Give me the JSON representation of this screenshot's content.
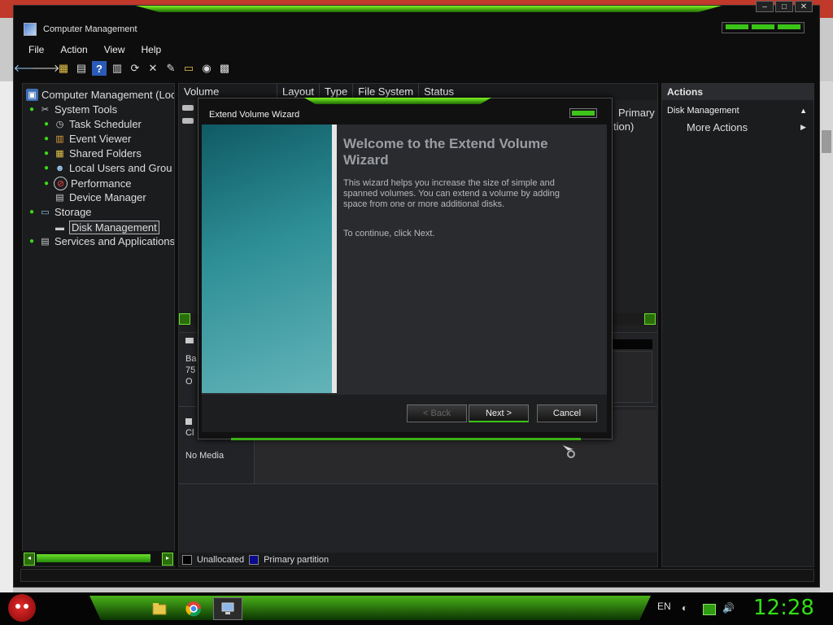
{
  "window": {
    "title": "Computer Management",
    "buttons": {
      "minimize": "–",
      "maximize": "□",
      "close": "✕"
    }
  },
  "menubar": [
    {
      "label": "File"
    },
    {
      "label": "Action"
    },
    {
      "label": "View"
    },
    {
      "label": "Help"
    }
  ],
  "toolbar": [
    {
      "icon": "back-arrow-icon",
      "glyph": "🡐"
    },
    {
      "icon": "forward-arrow-icon",
      "glyph": "🡒"
    },
    {
      "icon": "folder-up-icon",
      "glyph": "▦"
    },
    {
      "icon": "show-hide-console-tree-icon",
      "glyph": "▤"
    },
    {
      "icon": "help-icon",
      "glyph": "?"
    },
    {
      "icon": "properties-icon",
      "glyph": "▥"
    },
    {
      "icon": "refresh-icon",
      "glyph": "⟳"
    },
    {
      "icon": "delete-icon",
      "glyph": "✕"
    },
    {
      "icon": "edit-icon",
      "glyph": "✎"
    },
    {
      "icon": "open-folder-icon",
      "glyph": "▭"
    },
    {
      "icon": "search-disk-icon",
      "glyph": "◉"
    },
    {
      "icon": "grid-icon",
      "glyph": "▩"
    }
  ],
  "tree": {
    "root": "Computer Management (Loc",
    "system_tools": "System Tools",
    "task_scheduler": "Task Scheduler",
    "event_viewer": "Event Viewer",
    "shared_folders": "Shared Folders",
    "local_users": "Local Users and Grou",
    "performance": "Performance",
    "device_manager": "Device Manager",
    "storage": "Storage",
    "disk_management": "Disk Management",
    "services": "Services and Applications"
  },
  "volume_list": {
    "columns": [
      "Volume",
      "Layout",
      "Type",
      "File System",
      "Status"
    ],
    "partial_status": [
      "Primary",
      "tion)"
    ]
  },
  "disk_area": {
    "disk0_lines": [
      "Ba",
      "75",
      "O"
    ],
    "cd_label": "Cl",
    "cd_media": "No Media"
  },
  "legend": [
    {
      "label": "Unallocated",
      "color": "#000000"
    },
    {
      "label": "Primary partition",
      "color": "#0a0a8c"
    }
  ],
  "actions": {
    "header": "Actions",
    "section": "Disk Management",
    "more": "More Actions"
  },
  "wizard": {
    "title": "Extend Volume Wizard",
    "heading": "Welcome to the Extend Volume Wizard",
    "body": "This wizard helps you increase the size of simple and spanned volumes. You can extend a volume  by adding space from one or more additional disks.",
    "continue": "To continue, click Next.",
    "back": "< Back",
    "next": "Next >",
    "cancel": "Cancel"
  },
  "taskbar": {
    "language": "EN",
    "clock": "12:28"
  }
}
